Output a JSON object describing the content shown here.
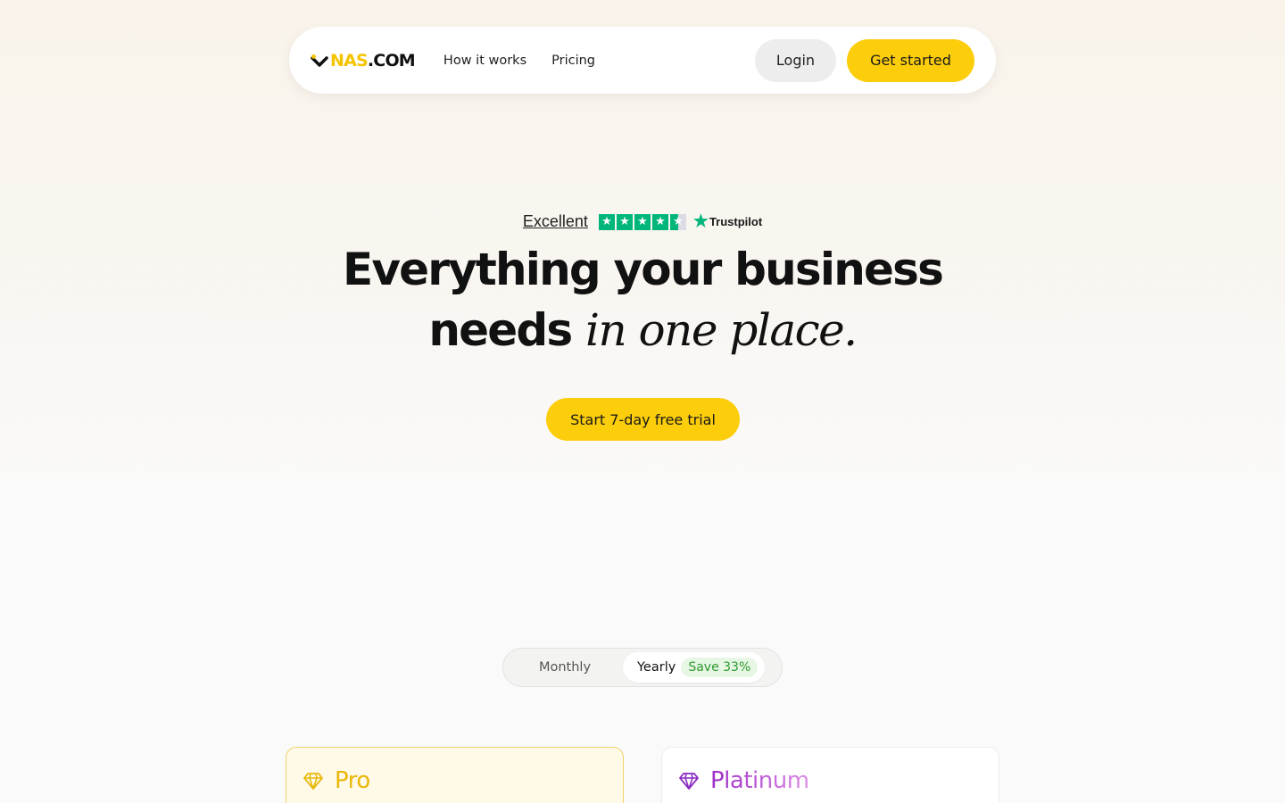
{
  "nav": {
    "logo_nas": "NAS",
    "logo_com": ".COM",
    "links": [
      "How it works",
      "Pricing"
    ],
    "login_label": "Login",
    "get_started_label": "Get started"
  },
  "rating": {
    "label": "Excellent",
    "stars_filled": 4.5,
    "stars_total": 5,
    "brand": "Trustpilot"
  },
  "hero": {
    "headline_line1": "Everything your business",
    "headline_line2": "needs",
    "headline_italic": "in one place.",
    "cta_label": "Start 7-day free trial"
  },
  "billing_toggle": {
    "monthly_label": "Monthly",
    "yearly_label": "Yearly",
    "save_badge": "Save 33%",
    "selected": "Yearly"
  },
  "plans": [
    {
      "name": "Pro",
      "color": "#e8b80a"
    },
    {
      "name": "Platinum",
      "color": "#9d2bc6"
    }
  ],
  "colors": {
    "accent": "#fccd0a",
    "trustpilot_green": "#00b67a",
    "save_green": "#2f9a2f"
  }
}
